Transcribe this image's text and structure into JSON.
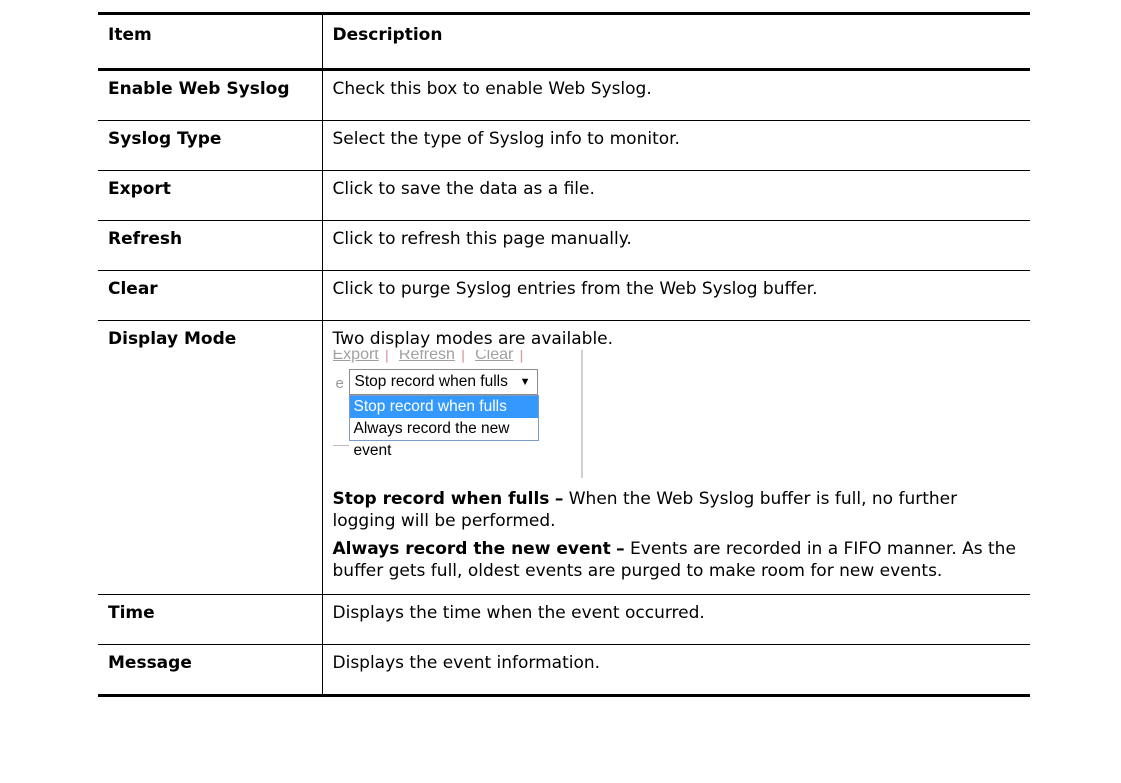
{
  "table": {
    "header": {
      "item": "Item",
      "description": "Description"
    },
    "rows": [
      {
        "item": "Enable Web Syslog",
        "description": "Check this box to enable Web Syslog."
      },
      {
        "item": "Syslog Type",
        "description": "Select the type of Syslog info to monitor."
      },
      {
        "item": "Export",
        "description": "Click to save the data as a file."
      },
      {
        "item": "Refresh",
        "description": "Click to refresh this page manually."
      },
      {
        "item": "Clear",
        "description": "Click to purge Syslog entries from the Web Syslog buffer."
      },
      {
        "item": "Display Mode",
        "description": "Two display modes are available."
      },
      {
        "item": "Time",
        "description": "Displays the time when the event occurred."
      },
      {
        "item": "Message",
        "description": "Displays the event information."
      }
    ]
  },
  "display_mode": {
    "snapshot": {
      "links": [
        "Export",
        "Refresh",
        "Clear"
      ],
      "separator": "|",
      "label_fragment": "e",
      "select_value": "Stop record when fulls",
      "options": [
        "Stop record when fulls",
        "Always record the new event"
      ]
    },
    "modes": [
      {
        "name": "Stop record when fulls",
        "dash": "–",
        "text": "When the Web Syslog buffer is full, no further logging will be performed."
      },
      {
        "name": "Always record the new event",
        "dash": "–",
        "text": "Events are recorded in a FIFO manner. As the buffer gets full, oldest events are purged to make room for new events."
      }
    ]
  }
}
